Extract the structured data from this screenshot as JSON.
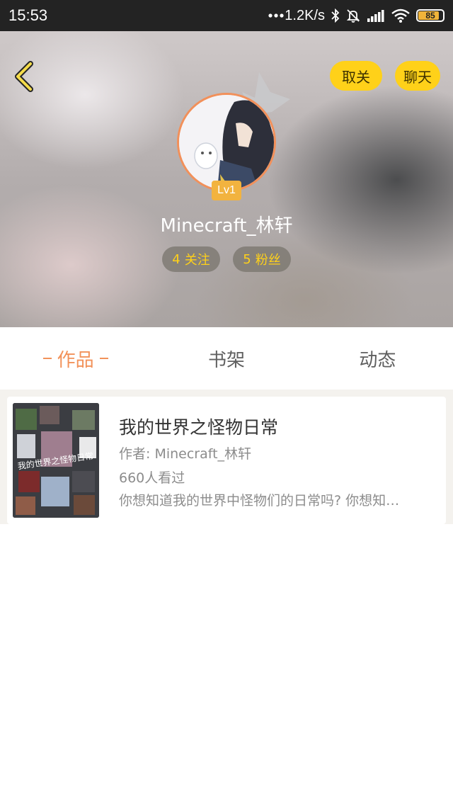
{
  "status_bar": {
    "time": "15:53",
    "network_speed": "1.2K/s",
    "battery": "85",
    "battery_level": 0.85
  },
  "header": {
    "unfollow_label": "取关",
    "chat_label": "聊天",
    "level": "Lv1",
    "username": "Minecraft_林轩",
    "following_count": "4",
    "following_label": "关注",
    "fans_count": "5",
    "fans_label": "粉丝"
  },
  "tabs": [
    {
      "label": "作品",
      "active": true
    },
    {
      "label": "书架",
      "active": false
    },
    {
      "label": "动态",
      "active": false
    }
  ],
  "books": [
    {
      "title": "我的世界之怪物日常",
      "author": "作者: Minecraft_林轩",
      "views": "660人看过",
      "description": "你想知道我的世界中怪物们的日常吗? 你想知…",
      "cover_text": "我的世界之怪物日常"
    }
  ],
  "colors": {
    "accent_yellow": "#ffd119",
    "accent_orange": "#f2925a",
    "level_badge": "#f2b33f"
  }
}
